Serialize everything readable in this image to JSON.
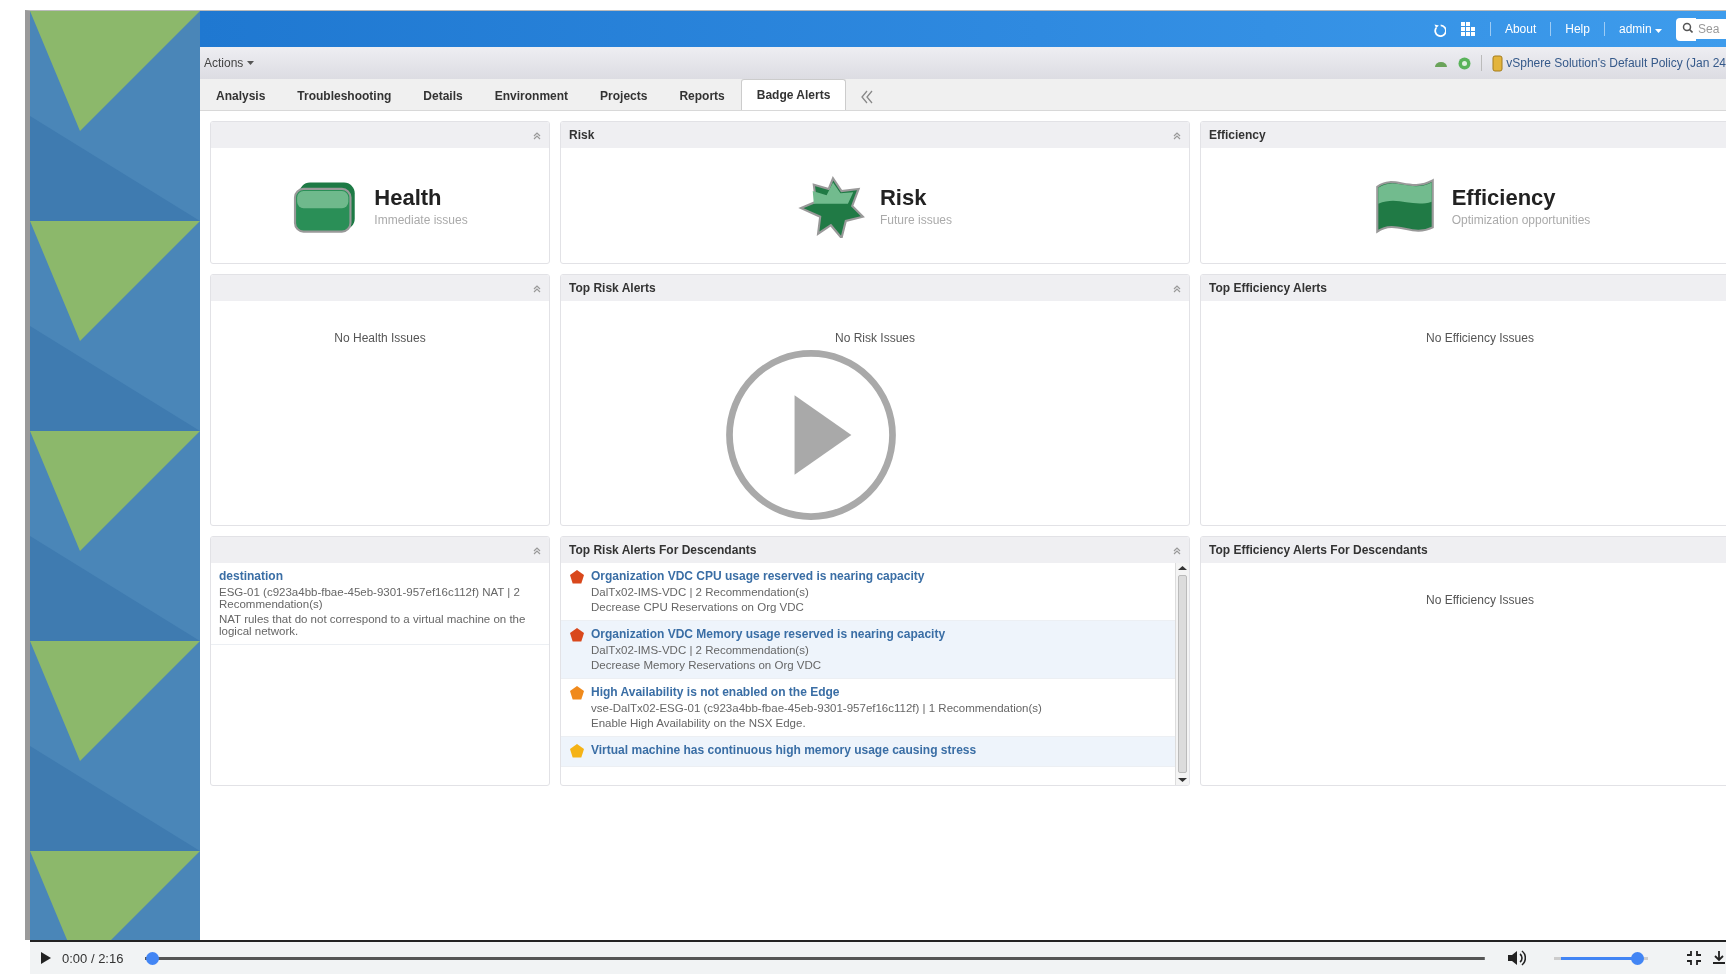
{
  "app_bar": {
    "links": [
      "About",
      "Help"
    ],
    "user": "admin",
    "search": {
      "placeholder": "Sea"
    }
  },
  "toolbar": {
    "actions": "Actions",
    "policy": "vSphere Solution's Default Policy (Jan 24"
  },
  "tabs": [
    {
      "label": "Analysis",
      "selected": false
    },
    {
      "label": "Troubleshooting",
      "selected": false
    },
    {
      "label": "Details",
      "selected": false
    },
    {
      "label": "Environment",
      "selected": false
    },
    {
      "label": "Projects",
      "selected": false
    },
    {
      "label": "Reports",
      "selected": false
    },
    {
      "label": "Badge Alerts",
      "selected": true
    }
  ],
  "panels": [
    {
      "kind": "health_badge",
      "collapse": true,
      "name": "Health",
      "subtitle": "Immediate issues"
    },
    {
      "kind": "risk_badge",
      "title": "Risk",
      "collapse": true,
      "name": "Risk",
      "subtitle": "Future issues"
    },
    {
      "kind": "efficiency_badge",
      "title": "Efficiency",
      "collapse": false,
      "name": "Efficiency",
      "subtitle": "Optimization opportunities"
    },
    {
      "kind": "empty",
      "collapse": true,
      "message": "No Health Issues"
    },
    {
      "kind": "empty",
      "title": "Top Risk Alerts",
      "collapse": true,
      "message": "No Risk Issues"
    },
    {
      "kind": "empty",
      "title": "Top Efficiency Alerts",
      "collapse": false,
      "message": "No Efficiency Issues"
    },
    {
      "kind": "alerts",
      "collapse": true,
      "scrollbar": false,
      "items": [
        {
          "title": "destination",
          "lines": [
            "ESG-01 (c923a4bb-fbae-45eb-9301-957ef16c112f) NAT | 2 Recommendation(s)",
            "NAT rules that do not correspond to a virtual machine on the logical network."
          ]
        }
      ]
    },
    {
      "kind": "alerts",
      "title": "Top Risk Alerts For Descendants",
      "collapse": true,
      "scrollbar": true,
      "items": [
        {
          "color": "#d9481c",
          "title": "Organization VDC CPU usage reserved is nearing capacity",
          "lines": [
            "DalTx02-IMS-VDC | 2 Recommendation(s)",
            "Decrease CPU Reservations on Org VDC"
          ]
        },
        {
          "color": "#d9481c",
          "title": "Organization VDC Memory usage reserved is nearing capacity",
          "lines": [
            "DalTx02-IMS-VDC | 2 Recommendation(s)",
            "Decrease Memory Reservations on Org VDC"
          ]
        },
        {
          "color": "#f08a1c",
          "title": "High Availability is not enabled on the Edge",
          "lines": [
            "vse-DalTx02-ESG-01 (c923a4bb-fbae-45eb-9301-957ef16c112f) | 1 Recommendation(s)",
            "Enable High Availability on the NSX Edge."
          ]
        },
        {
          "color": "#f5b316",
          "title": "Virtual machine has continuous high memory usage causing stress"
        }
      ]
    },
    {
      "kind": "empty",
      "title": "Top Efficiency Alerts For Descendants",
      "collapse": false,
      "message": "No Efficiency Issues"
    }
  ],
  "player": {
    "time": "0:00 / 2:16",
    "progress": {
      "level": 0
    },
    "volume": {
      "level": 0.95
    }
  }
}
